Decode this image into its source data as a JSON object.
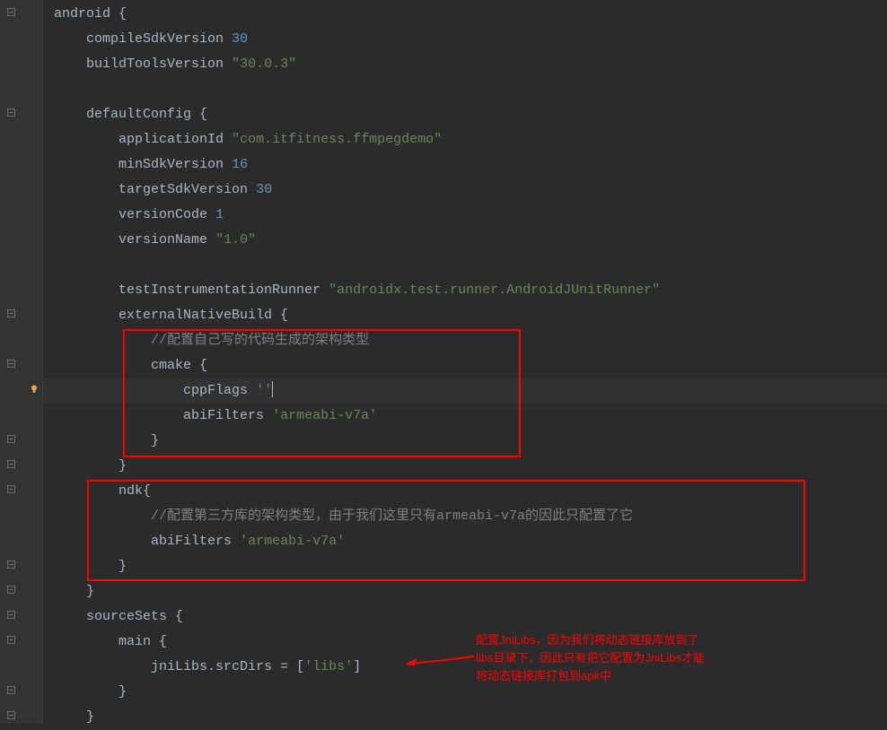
{
  "code": {
    "l1_android": "android",
    "l2_compile": "compileSdkVersion",
    "l2_compile_val": "30",
    "l3_buildtools": "buildToolsVersion",
    "l3_buildtools_val": "\"30.0.3\"",
    "l5_default": "defaultConfig",
    "l6_appid": "applicationId",
    "l6_appid_val": "\"com.itfitness.ffmpegdemo\"",
    "l7_minsdk": "minSdkVersion",
    "l7_minsdk_val": "16",
    "l8_targetsdk": "targetSdkVersion",
    "l8_targetsdk_val": "30",
    "l9_vcode": "versionCode",
    "l9_vcode_val": "1",
    "l10_vname": "versionName",
    "l10_vname_val": "\"1.0\"",
    "l12_testrunner": "testInstrumentationRunner",
    "l12_testrunner_val": "\"androidx.test.runner.AndroidJUnitRunner\"",
    "l13_extnative": "externalNativeBuild",
    "l14_comment": "//配置自己写的代码生成的架构类型",
    "l15_cmake": "cmake",
    "l16_cppflags": "cppFlags",
    "l16_cppflags_val": "''",
    "l17_abi": "abiFilters",
    "l17_abi_val": "'armeabi-v7a'",
    "l20_ndk": "ndk",
    "l21_comment": "//配置第三方库的架构类型，由于我们这里只有armeabi-v7a的因此只配置了它",
    "l22_abi": "abiFilters",
    "l22_abi_val": "'armeabi-v7a'",
    "l25_sourcesets": "sourceSets",
    "l26_main": "main",
    "l27_jnilibs": "jniLibs.srcDirs = [",
    "l27_jnilibs_val": "'libs'",
    "l27_close": "]"
  },
  "annotation": {
    "line1": "配置JniLibs，因为我们将动态链接库放到了",
    "line2": "libs目录下，因此只有把它配置为JniLibs才能",
    "line3": "将动态链接库打包到apk中"
  }
}
